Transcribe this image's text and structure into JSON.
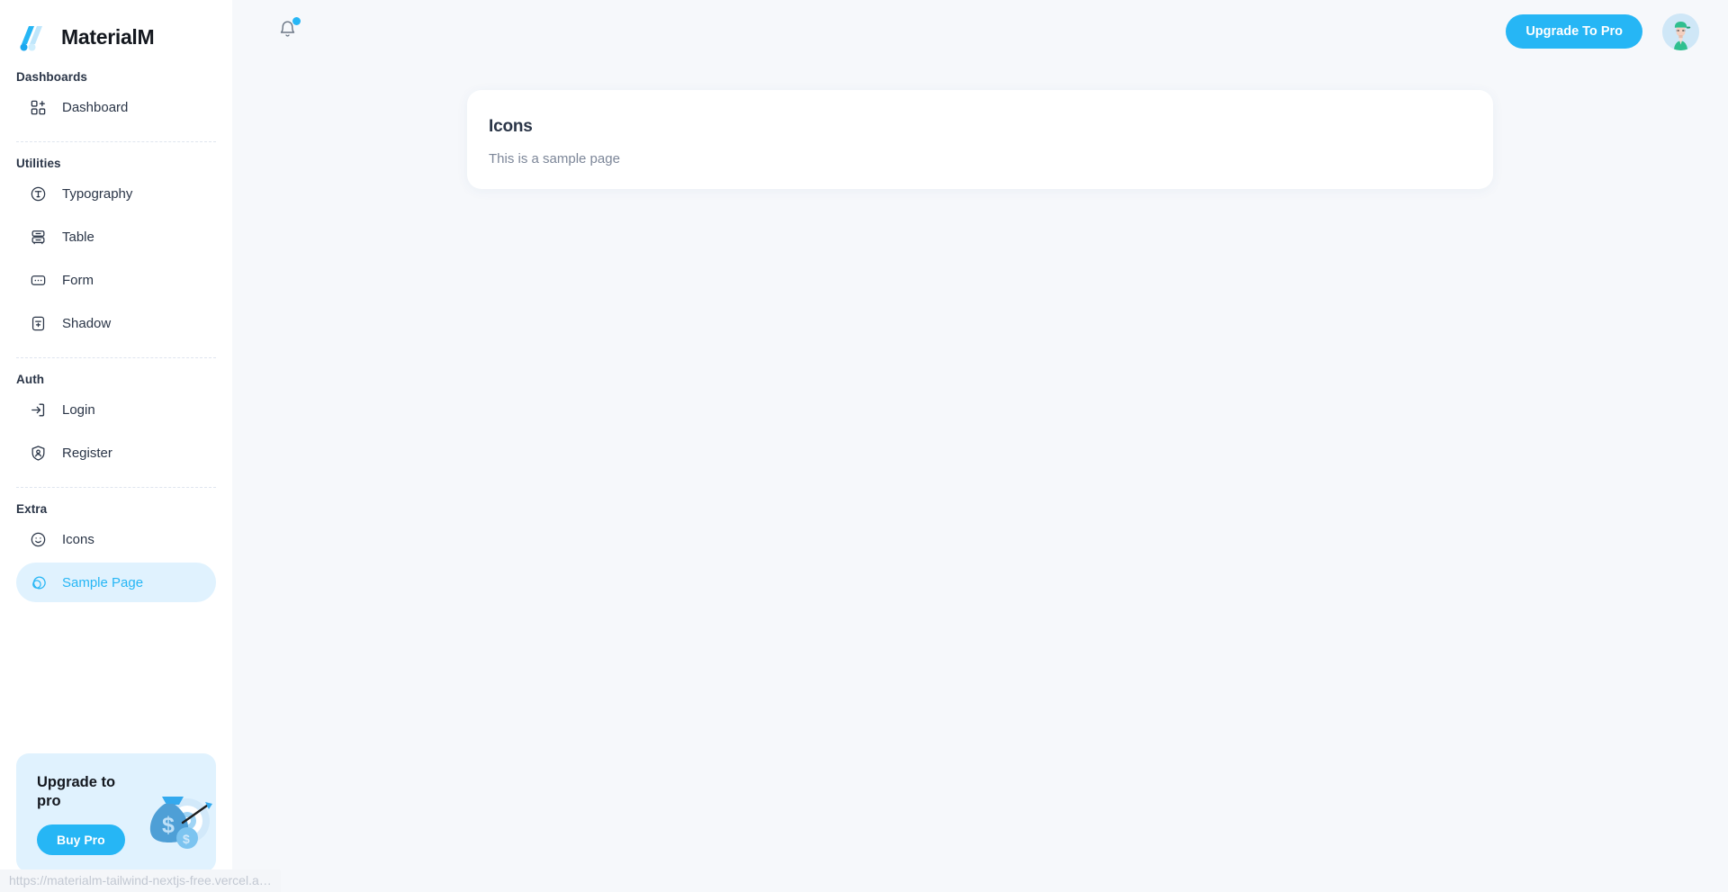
{
  "brand": {
    "name": "MaterialM",
    "logo_icon": "materialm-logo-icon"
  },
  "sidebar": {
    "sections": [
      {
        "title": "Dashboards",
        "items": [
          {
            "label": "Dashboard",
            "icon": "layout-grid-add-icon",
            "active": false
          }
        ]
      },
      {
        "title": "Utilities",
        "items": [
          {
            "label": "Typography",
            "icon": "typography-circle-t-icon",
            "active": false
          },
          {
            "label": "Table",
            "icon": "table-drawer-icon",
            "active": false
          },
          {
            "label": "Form",
            "icon": "form-dots-icon",
            "active": false
          },
          {
            "label": "Shadow",
            "icon": "shadow-box-icon",
            "active": false
          }
        ]
      },
      {
        "title": "Auth",
        "items": [
          {
            "label": "Login",
            "icon": "login-arrow-icon",
            "active": false
          },
          {
            "label": "Register",
            "icon": "register-user-shield-icon",
            "active": false
          }
        ]
      },
      {
        "title": "Extra",
        "items": [
          {
            "label": "Icons",
            "icon": "smiley-face-icon",
            "active": false
          },
          {
            "label": "Sample Page",
            "icon": "aperture-photo-icon",
            "active": true
          }
        ]
      }
    ],
    "upgrade_card": {
      "title": "Upgrade to pro",
      "button_label": "Buy Pro",
      "illustration_icon": "money-bag-target-illustration"
    }
  },
  "topbar": {
    "notification_icon": "bell-icon",
    "notification_badge": true,
    "upgrade_button_label": "Upgrade To Pro",
    "avatar_icon": "user-avatar"
  },
  "main": {
    "card": {
      "title": "Icons",
      "subtitle": "This is a sample page"
    }
  },
  "statusbar": {
    "url": "https://materialm-tailwind-nextjs-free.vercel.a…"
  },
  "colors": {
    "accent": "#26b6f5",
    "accent_soft": "#e0f2fe",
    "page_bg": "#f6f8fb",
    "sidebar_bg": "#ffffff",
    "text_primary": "#2a3547",
    "text_muted": "#7c8698"
  }
}
